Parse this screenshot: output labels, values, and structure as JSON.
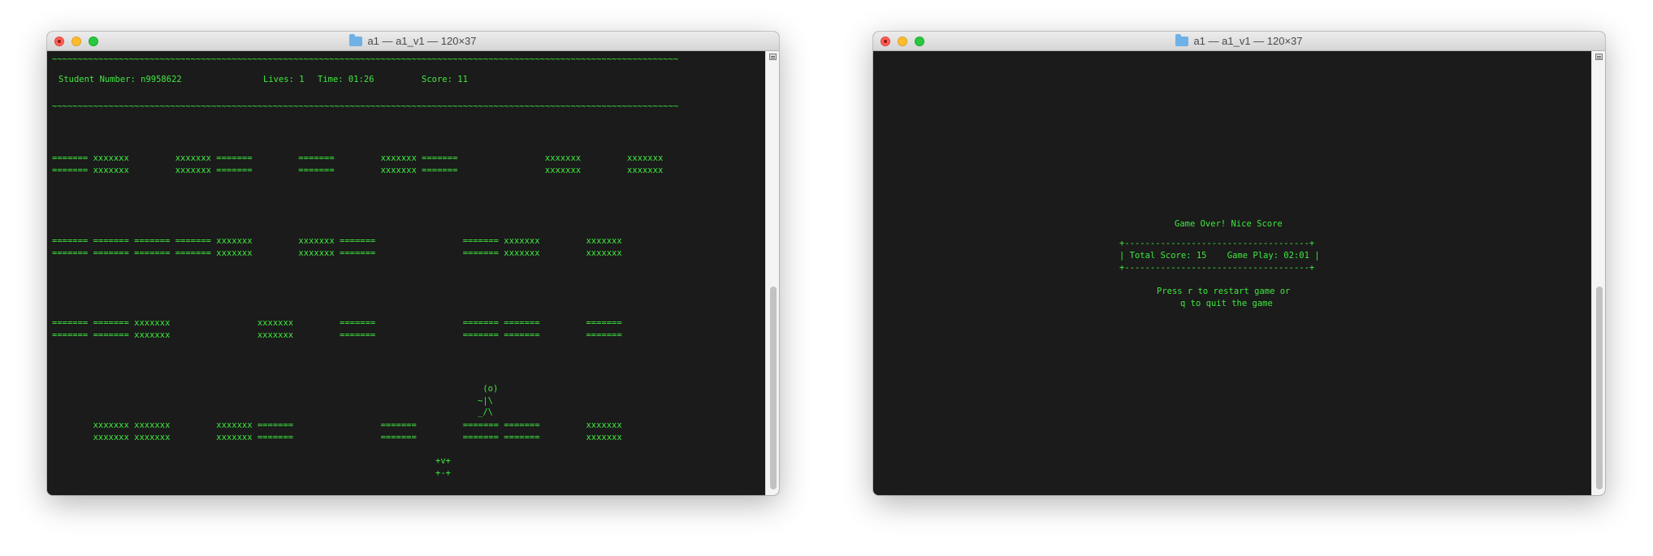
{
  "colors": {
    "terminal_bg": "#1b1b1b",
    "terminal_text": "#3fe83f",
    "titlebar": "#e4e4e4"
  },
  "left_window": {
    "title": "a1 — a1_v1 — 120×37",
    "border_top": "~~~~~~~~~~~~~~~~~~~~~~~~~~~~~~~~~~~~~~~~~~~~~~~~~~~~~~~~~~~~~~~~~~~~~~~~~~~~~~~~~~~~~~~~~~~~~~~~~~~~~~~~~~~~~~~~~~~~~~~~~~",
    "status": {
      "student_number": "Student Number: n9958622",
      "lives": "Lives: 1",
      "time": "Time: 01:26",
      "score": "Score: 11"
    },
    "border_bottom": "~~~~~~~~~~~~~~~~~~~~~~~~~~~~~~~~~~~~~~~~~~~~~~~~~~~~~~~~~~~~~~~~~~~~~~~~~~~~~~~~~~~~~~~~~~~~~~~~~~~~~~~~~~~~~~~~~~~~~~~~~~",
    "block_rows": [
      "======= xxxxxxx         xxxxxxx =======         =======         xxxxxxx =======                 xxxxxxx         xxxxxxx\n======= xxxxxxx         xxxxxxx =======         =======         xxxxxxx =======                 xxxxxxx         xxxxxxx",
      "======= ======= ======= ======= xxxxxxx         xxxxxxx =======                 ======= xxxxxxx         xxxxxxx\n======= ======= ======= ======= xxxxxxx         xxxxxxx =======                 ======= xxxxxxx         xxxxxxx",
      "======= ======= xxxxxxx                 xxxxxxx         =======                 ======= =======         =======\n======= ======= xxxxxxx                 xxxxxxx         =======                 ======= =======         =======",
      "        xxxxxxx xxxxxxx         xxxxxxx =======                 =======         ======= =======         xxxxxxx\n        xxxxxxx xxxxxxx         xxxxxxx =======                 =======         ======= =======         xxxxxxx"
    ],
    "hero": " (o)\n~|\\\n_/\\",
    "zombie": "+v+\n+-+"
  },
  "right_window": {
    "title": "a1 — a1_v1 — 120×37",
    "game_over": "Game Over! Nice Score",
    "box_top": "+------------------------------------+",
    "box_content": "| Total Score: 15    Game Play: 02:01 |",
    "box_bottom": "+------------------------------------+",
    "prompt_line1": "Press r to restart game or",
    "prompt_line2": "q to quit the game"
  }
}
